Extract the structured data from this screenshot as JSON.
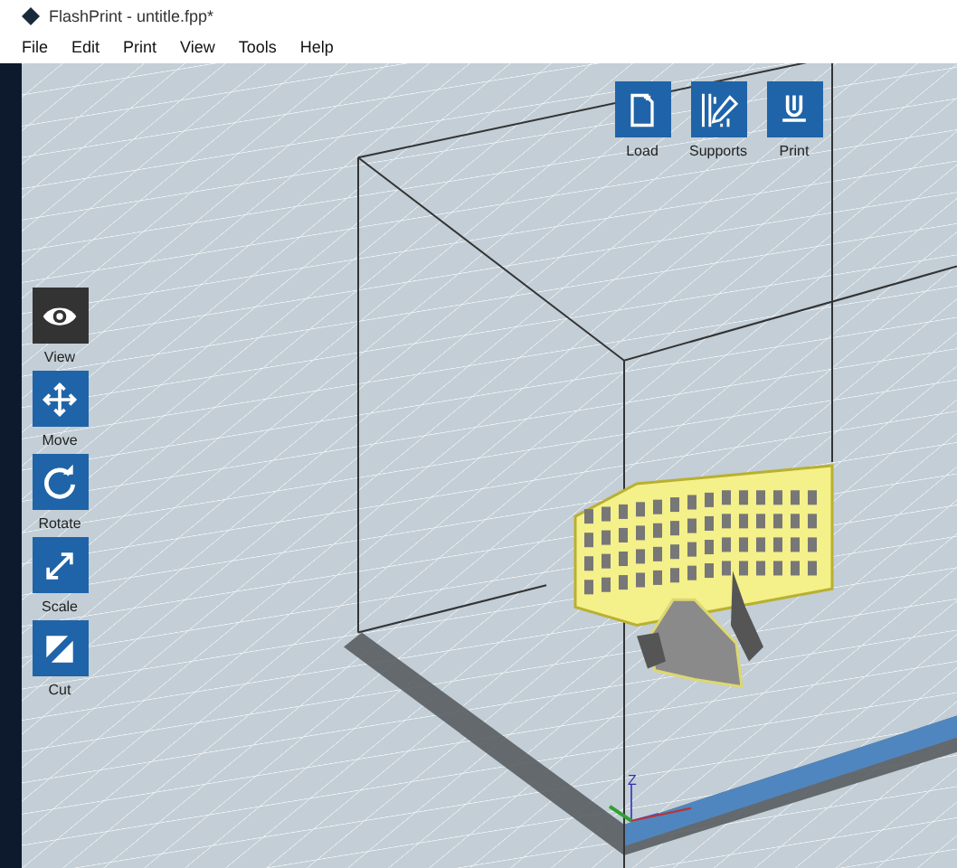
{
  "window": {
    "title": "FlashPrint - untitle.fpp*"
  },
  "menu": [
    "File",
    "Edit",
    "Print",
    "View",
    "Tools",
    "Help"
  ],
  "top_tools": [
    {
      "label": "Load",
      "kind": "load"
    },
    {
      "label": "Supports",
      "kind": "supports"
    },
    {
      "label": "Print",
      "kind": "print"
    }
  ],
  "side_tools": [
    {
      "label": "View",
      "kind": "view",
      "selected": true
    },
    {
      "label": "Move",
      "kind": "move",
      "selected": false
    },
    {
      "label": "Rotate",
      "kind": "rotate",
      "selected": false
    },
    {
      "label": "Scale",
      "kind": "scale",
      "selected": false
    },
    {
      "label": "Cut",
      "kind": "cut",
      "selected": false
    }
  ],
  "axis_label": "Z"
}
